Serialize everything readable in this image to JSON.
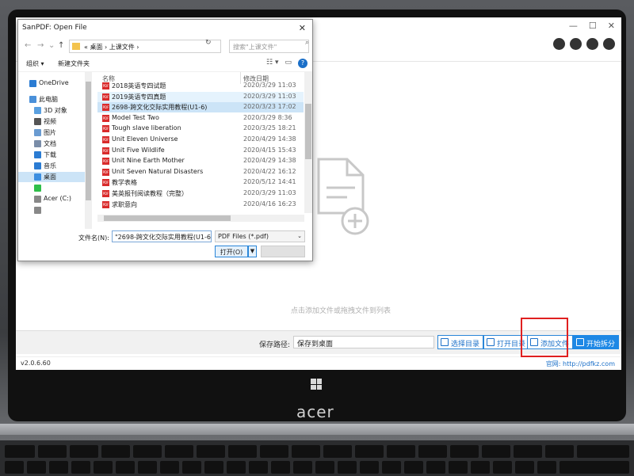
{
  "app": {
    "drop_hint": "点击添加文件或拖拽文件到列表",
    "save_path_label": "保存路径:",
    "save_path_value": "保存到桌面",
    "buttons": {
      "select_dir": "选择目录",
      "open_dir": "打开目录",
      "add_file": "添加文件",
      "start_split": "开始拆分"
    },
    "version": "v2.0.6.60",
    "site_label": "官网: http://pdfkz.com",
    "window_controls": [
      "—",
      "☐",
      "✕"
    ]
  },
  "dialog": {
    "title": "SanPDF: Open File",
    "close": "✕",
    "address": {
      "prefix": "«",
      "crumbs": "桌面  ›  上课文件  ›"
    },
    "search_placeholder": "搜索\"上课文件\"",
    "toolbar": {
      "organize": "组织 ▾",
      "new_folder": "新建文件夹"
    },
    "sidebar": [
      {
        "label": "OneDrive",
        "color": "#2b7cd3"
      },
      {
        "label": "此电脑",
        "color": "#4a90d9"
      },
      {
        "label": "3D 对象",
        "color": "#5aa0e0"
      },
      {
        "label": "视频",
        "color": "#555555"
      },
      {
        "label": "图片",
        "color": "#6a9bd1"
      },
      {
        "label": "文档",
        "color": "#7a8da8"
      },
      {
        "label": "下载",
        "color": "#2b7cd3"
      },
      {
        "label": "音乐",
        "color": "#2b7cd3"
      },
      {
        "label": "桌面",
        "color": "#3d8fe0"
      },
      {
        "label": "",
        "color": "#2fbf4a"
      },
      {
        "label": "Acer (C:)",
        "color": "#888888"
      },
      {
        "label": "",
        "color": "#888888"
      }
    ],
    "columns": {
      "name": "名称",
      "date": "修改日期"
    },
    "files": [
      {
        "name": "2018英语专四试题",
        "date": "2020/3/29 11:03"
      },
      {
        "name": "2019英语专四真题",
        "date": "2020/3/29 11:03"
      },
      {
        "name": "2698-跨文化交际实用教程(U1-6)",
        "date": "2020/3/23 17:02"
      },
      {
        "name": "Model Test Two",
        "date": "2020/3/29 8:36"
      },
      {
        "name": "Tough slave liberation",
        "date": "2020/3/25 18:21"
      },
      {
        "name": "Unit Eleven Universe",
        "date": "2020/4/29 14:38"
      },
      {
        "name": "Unit Five Wildlife",
        "date": "2020/4/15 15:43"
      },
      {
        "name": "Unit Nine Earth Mother",
        "date": "2020/4/29 14:38"
      },
      {
        "name": "Unit Seven Natural Disasters",
        "date": "2020/4/22 16:12"
      },
      {
        "name": "教学表格",
        "date": "2020/5/12 14:41"
      },
      {
        "name": "美英报刊阅读教程（完整）",
        "date": "2020/3/29 11:03"
      },
      {
        "name": "求职意向",
        "date": "2020/4/16 16:23"
      }
    ],
    "filename_label": "文件名(N):",
    "filename_value": "\"2698-跨文化交际实用教程(U1-6)\"",
    "filetype": "PDF Files (*.pdf)",
    "open_button": "打开(O)"
  },
  "device": {
    "brand": "acer"
  },
  "colors": {
    "accent": "#1e88e5",
    "highlight": "#e02020",
    "selection": "#cce4f7"
  }
}
